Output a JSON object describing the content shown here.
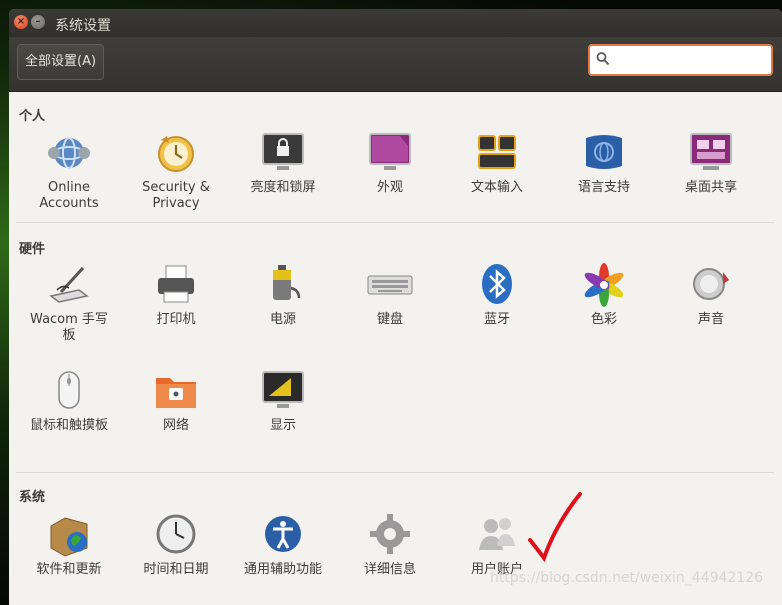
{
  "window": {
    "title": "系统设置"
  },
  "toolbar": {
    "all_settings_label": "全部设置(A)",
    "search_value": "",
    "search_icon": "search-icon"
  },
  "sections": {
    "personal": {
      "title": "个人",
      "items": [
        {
          "label": "Online\nAccounts",
          "icon": "online-accounts-icon"
        },
        {
          "label": "Security &\nPrivacy",
          "icon": "security-privacy-icon"
        },
        {
          "label": "亮度和锁屏",
          "icon": "brightness-lock-icon"
        },
        {
          "label": "外观",
          "icon": "appearance-icon"
        },
        {
          "label": "文本输入",
          "icon": "text-entry-icon"
        },
        {
          "label": "语言支持",
          "icon": "language-support-icon"
        },
        {
          "label": "桌面共享",
          "icon": "desktop-sharing-icon"
        }
      ]
    },
    "hardware": {
      "title": "硬件",
      "items": [
        {
          "label": "Wacom 手写\n板",
          "icon": "wacom-tablet-icon"
        },
        {
          "label": "打印机",
          "icon": "printer-icon"
        },
        {
          "label": "电源",
          "icon": "power-icon"
        },
        {
          "label": "键盘",
          "icon": "keyboard-icon"
        },
        {
          "label": "蓝牙",
          "icon": "bluetooth-icon"
        },
        {
          "label": "色彩",
          "icon": "color-icon"
        },
        {
          "label": "声音",
          "icon": "sound-icon"
        },
        {
          "label": "鼠标和触摸板",
          "icon": "mouse-touchpad-icon"
        },
        {
          "label": "网络",
          "icon": "network-icon"
        },
        {
          "label": "显示",
          "icon": "display-icon"
        }
      ]
    },
    "system": {
      "title": "系统",
      "items": [
        {
          "label": "软件和更新",
          "icon": "software-updates-icon"
        },
        {
          "label": "时间和日期",
          "icon": "time-date-icon"
        },
        {
          "label": "通用辅助功能",
          "icon": "accessibility-icon"
        },
        {
          "label": "详细信息",
          "icon": "details-icon"
        },
        {
          "label": "用户账户",
          "icon": "user-accounts-icon"
        }
      ]
    }
  },
  "annotation": {
    "mark": "checkmark",
    "color": "#e0101a"
  },
  "watermark": "https://blog.csdn.net/weixin_44942126"
}
